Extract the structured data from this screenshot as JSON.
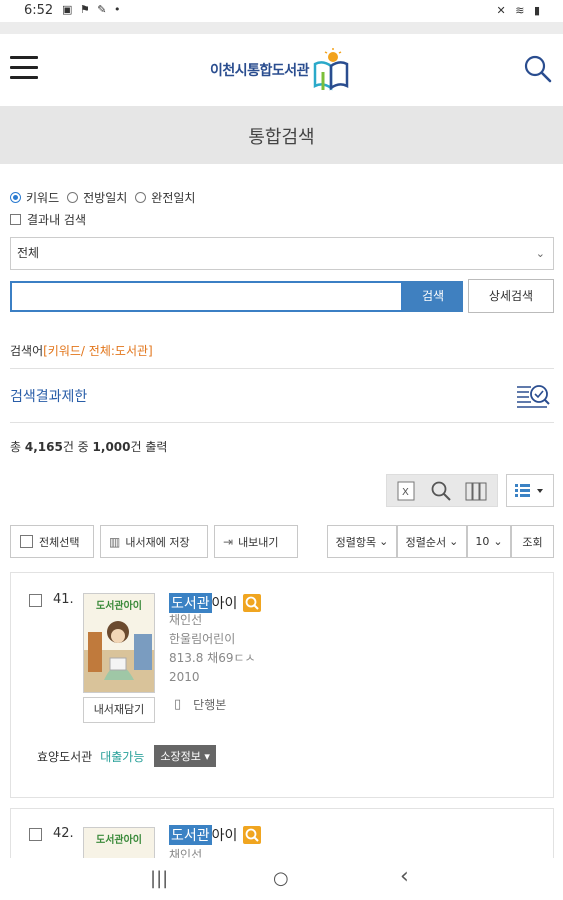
{
  "status_bar": {
    "time": "6:52",
    "left_icons": [
      "gallery-icon",
      "notification-icon",
      "tool-icon",
      "dot-icon"
    ],
    "right_icons": [
      "mute-icon",
      "wifi-icon",
      "battery-icon"
    ]
  },
  "header": {
    "logo_text": "이천시통합도서관",
    "menu_icon": "hamburger-icon",
    "search_icon": "search-icon"
  },
  "page_title": "통합검색",
  "search_options": {
    "radios": [
      {
        "label": "키워드",
        "checked": true
      },
      {
        "label": "전방일치",
        "checked": false
      },
      {
        "label": "완전일치",
        "checked": false
      }
    ],
    "in_results_label": "결과내 검색",
    "scope_select": "전체",
    "input_value": "",
    "submit_label": "검색",
    "detail_label": "상세검색"
  },
  "query_summary": {
    "prefix": "검색어",
    "highlight": "[키워드/ 전체:도서관]"
  },
  "result_limit_label": "검색결과제한",
  "result_count": {
    "prefix": "총 ",
    "total": "4,165",
    "middle": "건 중 ",
    "shown": "1,000",
    "suffix": "건 출력"
  },
  "toolbar": {
    "select_all": "전체선택",
    "save_shelf": "내서재에 저장",
    "export": "내보내기",
    "sort_field": "정렬항목",
    "sort_order": "정렬순서",
    "page_size": "10",
    "query_btn": "조회"
  },
  "results": [
    {
      "num": "41.",
      "cover_title": "도서관아이",
      "title_hl": "도서관",
      "title_rest": " 아이",
      "author": "채인선",
      "publisher": "한울림어린이",
      "callno": "813.8 채69ㄷㅅ",
      "year": "2010",
      "type": "단행본",
      "save_label": "내서재담기",
      "library": "효양도서관",
      "status": "대출가능",
      "info_btn": "소장정보 ▾"
    },
    {
      "num": "42.",
      "cover_title": "도서관아이",
      "title_hl": "도서관",
      "title_rest": " 아이",
      "author": "채인선"
    }
  ],
  "nav_bar": {
    "recent": "|||",
    "home": "○",
    "back": "‹"
  }
}
